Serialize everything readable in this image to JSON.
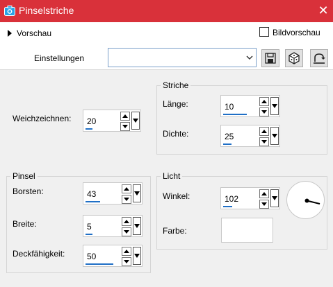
{
  "window": {
    "title": "Pinselstriche",
    "close_glyph": "✕",
    "accent": "#d9313a"
  },
  "preview": {
    "label": "Vorschau",
    "bild_label": "Bildvorschau",
    "bild_checked": false
  },
  "settings": {
    "label": "Einstellungen",
    "value": ""
  },
  "blur": {
    "label": "Weichzeichnen:",
    "value": "20",
    "fill": 0.2
  },
  "striche": {
    "title": "Striche",
    "length": {
      "label": "Länge:",
      "value": "10",
      "fill": 0.7
    },
    "density": {
      "label": "Dichte:",
      "value": "25",
      "fill": 0.25
    }
  },
  "pinsel": {
    "title": "Pinsel",
    "bristles": {
      "label": "Borsten:",
      "value": "43",
      "fill": 0.43
    },
    "width": {
      "label": "Breite:",
      "value": "5",
      "fill": 0.2
    },
    "opacity": {
      "label": "Deckfähigkeit:",
      "value": "50",
      "fill": 0.95
    }
  },
  "licht": {
    "title": "Licht",
    "angle": {
      "label": "Winkel:",
      "value": "102",
      "fill": 0.28
    },
    "color": {
      "label": "Farbe:",
      "value": "#ffffff"
    }
  }
}
